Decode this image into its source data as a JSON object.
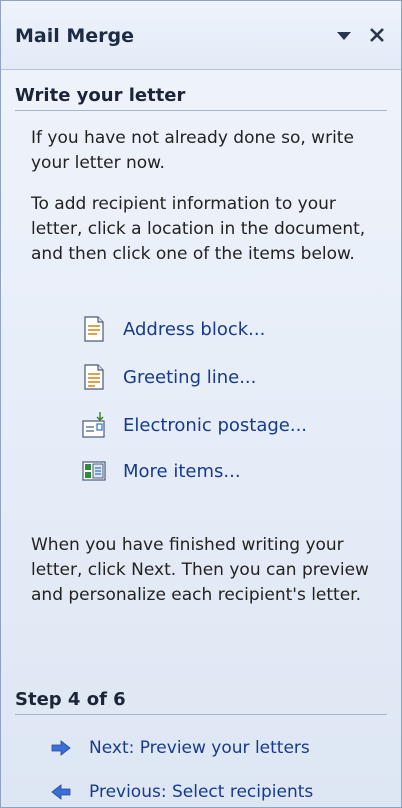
{
  "pane": {
    "title": "Mail Merge",
    "dropdown_icon": "chevron-down-icon",
    "close_icon": "close-icon"
  },
  "write_section": {
    "heading": "Write your letter",
    "intro": "If you have not already done so, write your letter now.",
    "instructions": "To add recipient information to your letter, click a location in the document, and then click one of the items below.",
    "items": [
      {
        "label": "Address block...",
        "icon": "document-icon"
      },
      {
        "label": "Greeting line...",
        "icon": "document-lines-icon"
      },
      {
        "label": "Electronic postage...",
        "icon": "postage-icon"
      },
      {
        "label": "More items...",
        "icon": "more-items-icon"
      }
    ],
    "outro": "When you have finished writing your letter, click Next. Then you can preview and personalize each recipient's letter."
  },
  "step_section": {
    "heading": "Step 4 of 6",
    "next_label": "Next: Preview your letters",
    "previous_label": "Previous: Select recipients"
  },
  "colors": {
    "link": "#163a8c",
    "arrow": "#3b6fd6",
    "pane_bg": "#e5ecf7"
  }
}
